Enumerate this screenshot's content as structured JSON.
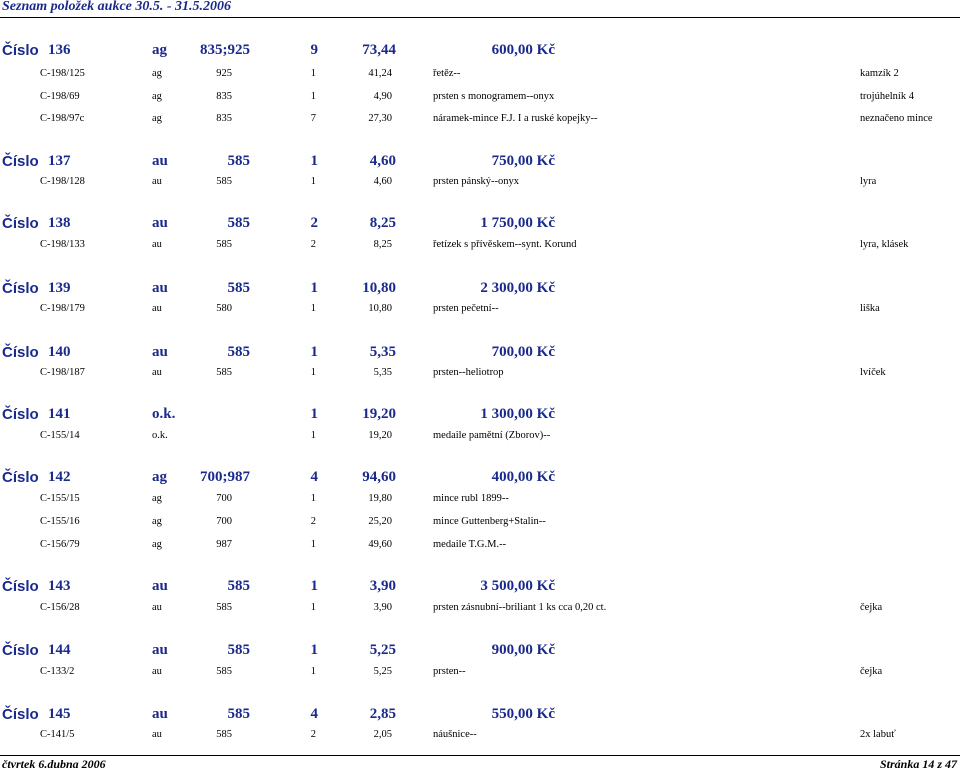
{
  "header": {
    "title": "Seznam položek aukce 30.5. - 31.5.2006"
  },
  "lots": [
    {
      "label": "Číslo",
      "number": "136",
      "metal": "ag",
      "fineness": "835;925",
      "count": "9",
      "weight": "73,44",
      "price": "600,00 Kč",
      "items": [
        {
          "code": "C-198/125",
          "metal": "ag",
          "fineness": "925",
          "count": "1",
          "weight": "41,24",
          "desc": "řetěz--",
          "mark": "kamzík 2"
        },
        {
          "code": "C-198/69",
          "metal": "ag",
          "fineness": "835",
          "count": "1",
          "weight": "4,90",
          "desc": "prsten s monogramem--onyx",
          "mark": "trojúhelník 4"
        },
        {
          "code": "C-198/97c",
          "metal": "ag",
          "fineness": "835",
          "count": "7",
          "weight": "27,30",
          "desc": "náramek-mince F.J. I a ruské kopejky--",
          "mark": "neznačeno mince"
        }
      ]
    },
    {
      "label": "Číslo",
      "number": "137",
      "metal": "au",
      "fineness": "585",
      "count": "1",
      "weight": "4,60",
      "price": "750,00 Kč",
      "items": [
        {
          "code": "C-198/128",
          "metal": "au",
          "fineness": "585",
          "count": "1",
          "weight": "4,60",
          "desc": "prsten pánský--onyx",
          "mark": "lyra"
        }
      ]
    },
    {
      "label": "Číslo",
      "number": "138",
      "metal": "au",
      "fineness": "585",
      "count": "2",
      "weight": "8,25",
      "price": "1 750,00 Kč",
      "items": [
        {
          "code": "C-198/133",
          "metal": "au",
          "fineness": "585",
          "count": "2",
          "weight": "8,25",
          "desc": "řetízek s přívěskem--synt. Korund",
          "mark": "lyra, klásek"
        }
      ]
    },
    {
      "label": "Číslo",
      "number": "139",
      "metal": "au",
      "fineness": "585",
      "count": "1",
      "weight": "10,80",
      "price": "2 300,00 Kč",
      "items": [
        {
          "code": "C-198/179",
          "metal": "au",
          "fineness": "580",
          "count": "1",
          "weight": "10,80",
          "desc": "prsten pečetní--",
          "mark": "liška"
        }
      ]
    },
    {
      "label": "Číslo",
      "number": "140",
      "metal": "au",
      "fineness": "585",
      "count": "1",
      "weight": "5,35",
      "price": "700,00 Kč",
      "items": [
        {
          "code": "C-198/187",
          "metal": "au",
          "fineness": "585",
          "count": "1",
          "weight": "5,35",
          "desc": "prsten--heliotrop",
          "mark": "lvíček"
        }
      ]
    },
    {
      "label": "Číslo",
      "number": "141",
      "metal": "o.k.",
      "fineness": "",
      "count": "1",
      "weight": "19,20",
      "price": "1 300,00 Kč",
      "items": [
        {
          "code": "C-155/14",
          "metal": "o.k.",
          "fineness": "",
          "count": "1",
          "weight": "19,20",
          "desc": "medaile pamětní (Zborov)--",
          "mark": ""
        }
      ]
    },
    {
      "label": "Číslo",
      "number": "142",
      "metal": "ag",
      "fineness": "700;987",
      "count": "4",
      "weight": "94,60",
      "price": "400,00 Kč",
      "items": [
        {
          "code": "C-155/15",
          "metal": "ag",
          "fineness": "700",
          "count": "1",
          "weight": "19,80",
          "desc": "mince rubl 1899--",
          "mark": ""
        },
        {
          "code": "C-155/16",
          "metal": "ag",
          "fineness": "700",
          "count": "2",
          "weight": "25,20",
          "desc": "mince Guttenberg+Stalin--",
          "mark": ""
        },
        {
          "code": "C-156/79",
          "metal": "ag",
          "fineness": "987",
          "count": "1",
          "weight": "49,60",
          "desc": "medaile T.G.M.--",
          "mark": ""
        }
      ]
    },
    {
      "label": "Číslo",
      "number": "143",
      "metal": "au",
      "fineness": "585",
      "count": "1",
      "weight": "3,90",
      "price": "3 500,00 Kč",
      "items": [
        {
          "code": "C-156/28",
          "metal": "au",
          "fineness": "585",
          "count": "1",
          "weight": "3,90",
          "desc": "prsten zásnubní--briliant 1 ks cca 0,20 ct.",
          "mark": "čejka"
        }
      ]
    },
    {
      "label": "Číslo",
      "number": "144",
      "metal": "au",
      "fineness": "585",
      "count": "1",
      "weight": "5,25",
      "price": "900,00 Kč",
      "items": [
        {
          "code": "C-133/2",
          "metal": "au",
          "fineness": "585",
          "count": "1",
          "weight": "5,25",
          "desc": "prsten--",
          "mark": "čejka"
        }
      ]
    },
    {
      "label": "Číslo",
      "number": "145",
      "metal": "au",
      "fineness": "585",
      "count": "4",
      "weight": "2,85",
      "price": "550,00 Kč",
      "items": [
        {
          "code": "C-141/5",
          "metal": "au",
          "fineness": "585",
          "count": "2",
          "weight": "2,05",
          "desc": "náušnice--",
          "mark": "2x labuť"
        }
      ]
    }
  ],
  "footer": {
    "date": "čtvrtek 6.dubna 2006",
    "page": "Stránka 14 z 47"
  }
}
